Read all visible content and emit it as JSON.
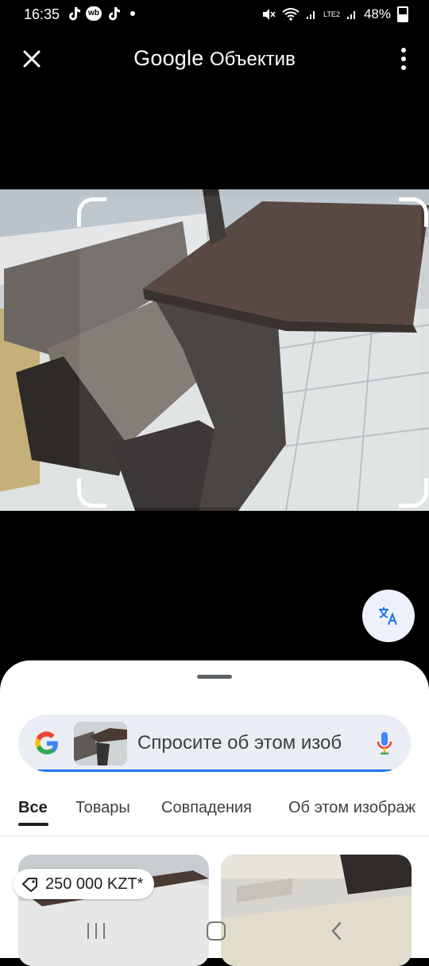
{
  "status_bar": {
    "time": "16:35",
    "notification_icons": [
      "tiktok-icon",
      "wb-icon",
      "tiktok-icon",
      "dot-icon"
    ],
    "wb_label": "wb",
    "signal_label": "LTE2",
    "battery_percent": "48%"
  },
  "header": {
    "brand": "Google",
    "product": "Объектив"
  },
  "search": {
    "placeholder": "Спросите об этом изоб"
  },
  "tabs": [
    {
      "label": "Все",
      "active": true
    },
    {
      "label": "Товары",
      "active": false
    },
    {
      "label": "Совпадения",
      "active": false
    },
    {
      "label": "Об этом изображ",
      "active": false
    }
  ],
  "results": [
    {
      "price": "250 000 KZT*"
    },
    {
      "price": ""
    }
  ],
  "colors": {
    "accent": "#1a73e8",
    "sheet_bg": "#ffffff",
    "search_bg": "#eaedf3"
  }
}
